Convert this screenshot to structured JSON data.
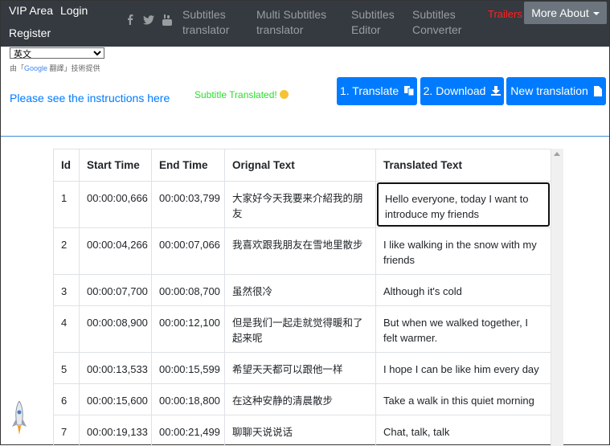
{
  "nav": {
    "vip": "VIP Area",
    "login": "Login",
    "register": "Register",
    "social_icons": [
      "facebook-icon",
      "twitter-icon",
      "youtube-icon"
    ],
    "links": [
      {
        "line1": "Subtitles",
        "line2": "translator"
      },
      {
        "line1": "Multi Subtitles",
        "line2": "translator"
      },
      {
        "line1": "Subtitles",
        "line2": "Editor"
      },
      {
        "line1": "Subtitles",
        "line2": "Converter"
      }
    ],
    "trailers": "Trailers",
    "more_about": "More About",
    "colors": {
      "bg": "#343a40",
      "trailers": "#ff2222",
      "more_btn": "#6c757d"
    }
  },
  "google_translate": {
    "selected_language": "英文",
    "credit_prefix": "由「",
    "credit_google": "Google",
    "credit_suffix": " 翻譯」技術提供"
  },
  "instructions_link": "Please see the instructions here",
  "status": {
    "text": "Subtitle Translated!",
    "color": "#28e028"
  },
  "buttons": {
    "translate": "1. Translate",
    "download": "2. Download",
    "new_translation": "New translation",
    "color": "#007bff"
  },
  "table": {
    "headers": [
      "Id",
      "Start Time",
      "End Time",
      "Orignal Text",
      "Translated Text"
    ],
    "rows": [
      {
        "id": "1",
        "start": "00:00:00,666",
        "end": "00:00:03,799",
        "original": "大家好今天我要来介紹我的朋友",
        "translated": "Hello everyone, today I want to introduce my friends"
      },
      {
        "id": "2",
        "start": "00:00:04,266",
        "end": "00:00:07,066",
        "original": "我喜欢跟我朋友在雪地里散步",
        "translated": "I like walking in the snow with my friends"
      },
      {
        "id": "3",
        "start": "00:00:07,700",
        "end": "00:00:08,700",
        "original": "虽然很冷",
        "translated": "Although it's cold"
      },
      {
        "id": "4",
        "start": "00:00:08,900",
        "end": "00:00:12,100",
        "original": "但是我们一起走就觉得暖和了起来呢",
        "translated": "But when we walked together, I felt warmer."
      },
      {
        "id": "5",
        "start": "00:00:13,533",
        "end": "00:00:15,599",
        "original": "希望天天都可以跟他一样",
        "translated": "I hope I can be like him every day"
      },
      {
        "id": "6",
        "start": "00:00:15,600",
        "end": "00:00:18,800",
        "original": "在这种安静的清晨散步",
        "translated": "Take a walk in this quiet morning"
      },
      {
        "id": "7",
        "start": "00:00:19,133",
        "end": "00:00:21,499",
        "original": "聊聊天说说话",
        "translated": "Chat, talk, talk"
      }
    ]
  }
}
